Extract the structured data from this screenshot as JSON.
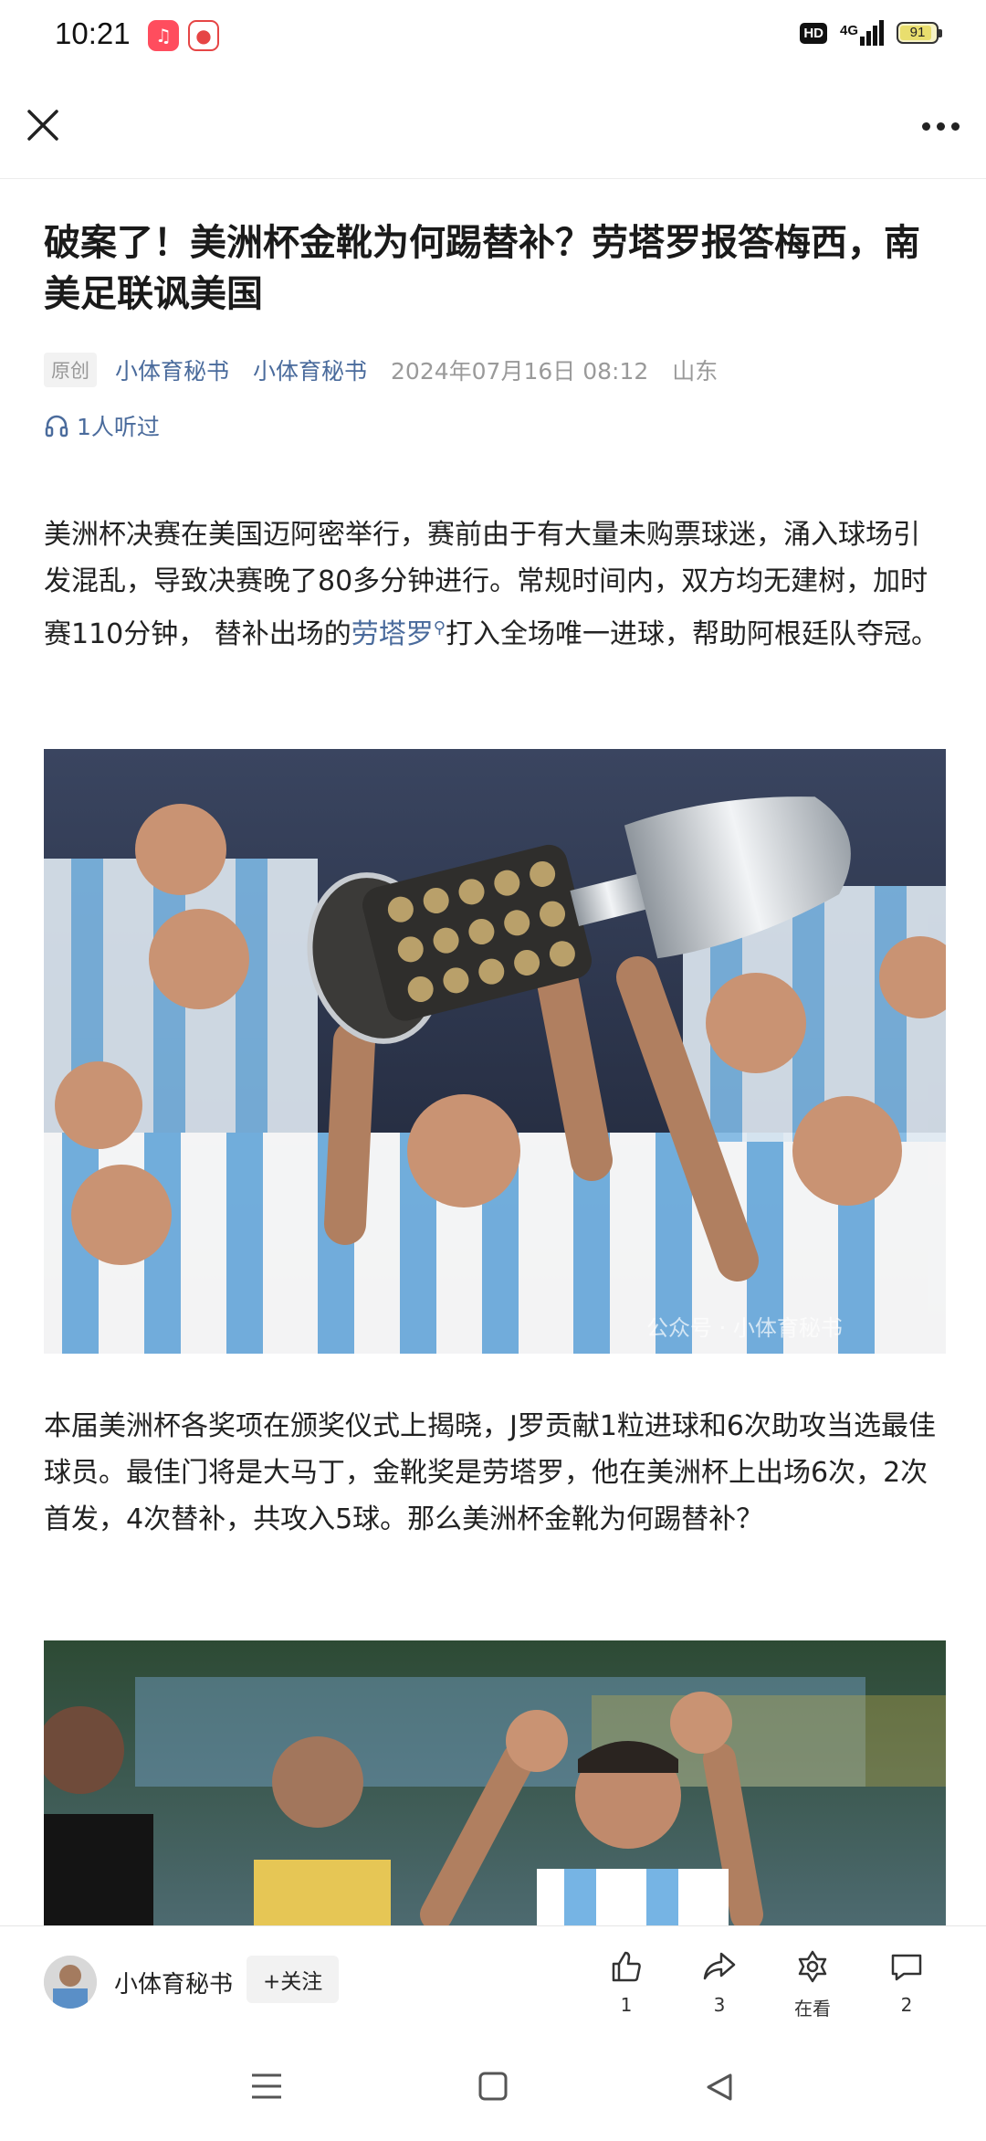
{
  "status": {
    "time": "10:21",
    "hd": "HD",
    "network": "4G",
    "battery": "91",
    "battery_level": 0.91
  },
  "article": {
    "title": "破案了！美洲杯金靴为何踢替补？劳塔罗报答梅西，南美足联讽美国",
    "original_tag": "原创",
    "author1": "小体育秘书",
    "author2": "小体育秘书",
    "datetime": "2024年07月16日 08:12",
    "location": "山东",
    "listeners": "1人听过",
    "p1_before": "美洲杯决赛在美国迈阿密举行，赛前由于有大量未购票球迷，涌入球场引发混乱，导致决赛晚了80多分钟进行。常规时间内，双方均无建树，加时赛110分钟， 替补出场的",
    "p1_link": "劳塔罗",
    "p1_after": "打入全场唯一进球，帮助阿根廷队夺冠。",
    "watermark": "公众号 · 小体育秘书",
    "p2": "本届美洲杯各奖项在颁奖仪式上揭晓，J罗贡献1粒进球和6次助攻当选最佳球员。最佳门将是大马丁，金靴奖是劳塔罗，他在美洲杯上出场6次，2次首发，4次替补，共攻入5球。那么美洲杯金靴为何踢替补？"
  },
  "bottom": {
    "author": "小体育秘书",
    "follow": "+关注",
    "like_count": "1",
    "share_count": "3",
    "watching_label": "在看",
    "comment_count": "2"
  }
}
